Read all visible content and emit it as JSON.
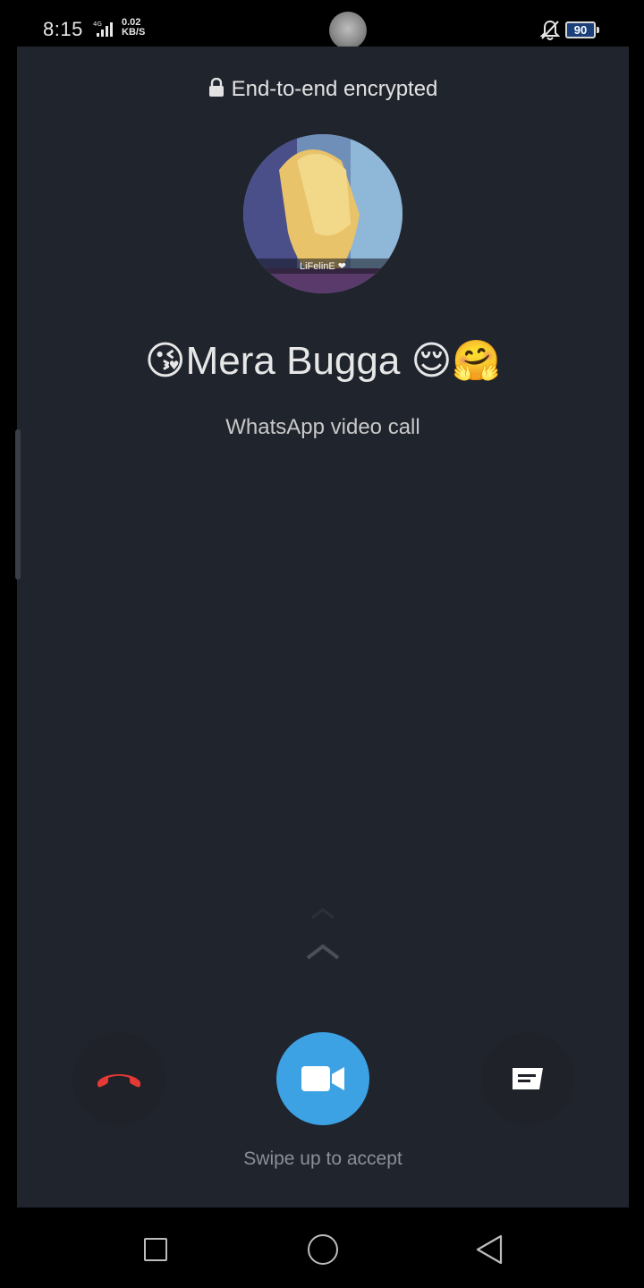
{
  "status_bar": {
    "time": "8:15",
    "network_type": "4G",
    "speed_value": "0.02",
    "speed_unit": "KB/S",
    "battery": "90"
  },
  "call": {
    "encryption_notice": "End-to-end encrypted",
    "avatar_caption": "LiFelinE ❤",
    "caller_name": "😘Mera Bugga 😌🤗",
    "call_type": "WhatsApp video call",
    "swipe_hint": "Swipe up to accept"
  },
  "colors": {
    "panel_background": "#20242d",
    "accept_accent": "#3da2e4",
    "decline_red": "#e53935"
  },
  "icons": {
    "decline": "phone-hangup-icon",
    "accept": "video-camera-icon",
    "message": "message-icon",
    "lock": "lock-icon"
  }
}
